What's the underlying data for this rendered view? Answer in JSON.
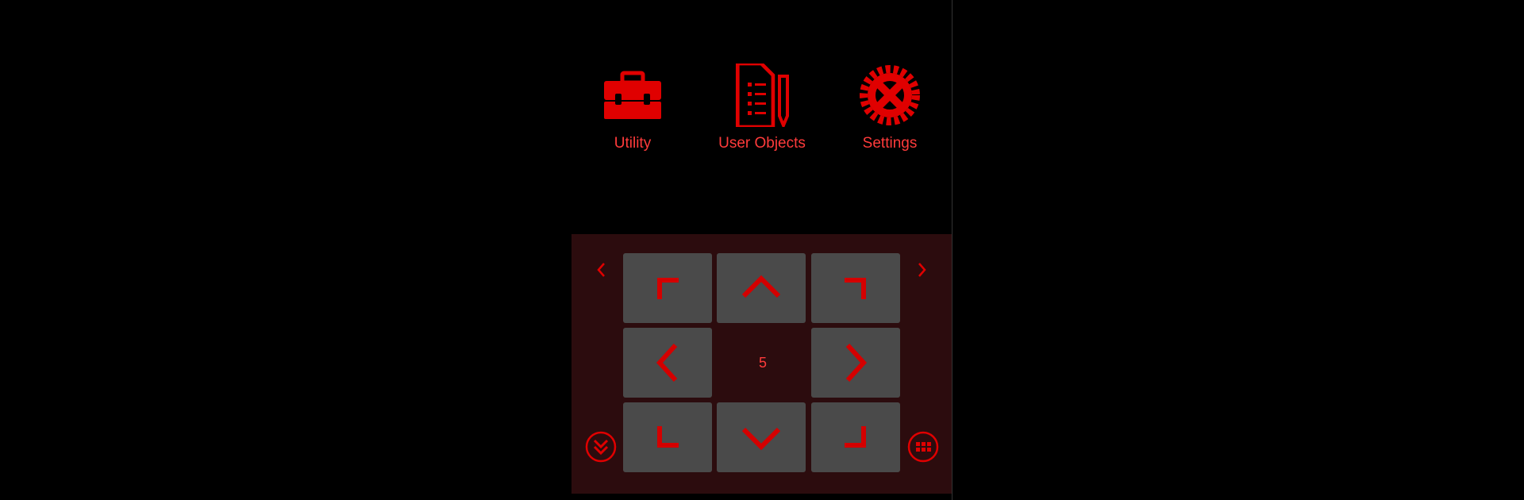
{
  "menu": {
    "items": [
      {
        "label": "Utility",
        "icon": "toolbox-icon"
      },
      {
        "label": "User Objects",
        "icon": "document-pencil-icon"
      },
      {
        "label": "Settings",
        "icon": "gear-icon"
      }
    ]
  },
  "pad": {
    "center_value": "5",
    "keys": [
      "up-left",
      "up",
      "up-right",
      "left",
      "right",
      "down-left",
      "down",
      "down-right"
    ]
  },
  "colors": {
    "accent": "#e00000",
    "label": "#ff3b3b",
    "pad_bg": "#2c0c0e",
    "key_bg": "#4a4a4a"
  }
}
